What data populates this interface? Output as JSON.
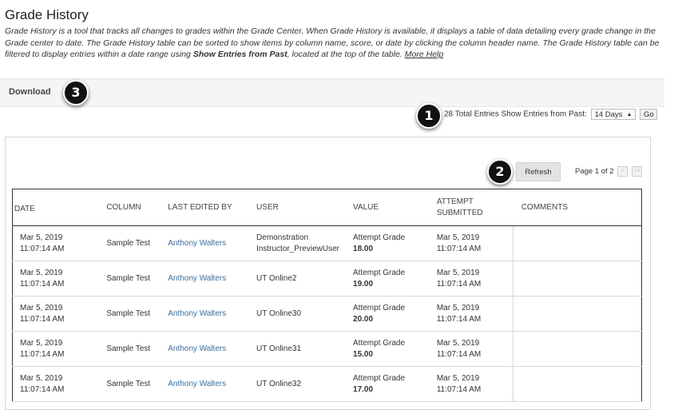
{
  "page": {
    "title": "Grade History",
    "description_part1": "Grade History is a tool that tracks all changes to grades within the Grade Center. When Grade History is available, it displays a table of data detailing every grade change in the Grade center to date. The Grade History table can be sorted to show items by column name, score, or date by clicking the column header name. The Grade History table can be filtered to display entries within a date range using ",
    "description_bold": "Show Entries from Past",
    "description_part2": ", located at the top of the table. ",
    "more_help_link": "More Help"
  },
  "toolbar": {
    "download_label": "Download"
  },
  "callouts": {
    "one": "1",
    "two": "2",
    "three": "3"
  },
  "filter": {
    "total_text": "28 Total Entries",
    "show_label": "Show Entries from Past:",
    "selected": "14 Days",
    "go_label": "Go"
  },
  "pager": {
    "refresh_label": "Refresh",
    "page_text": "Page 1 of 2",
    "next": ">",
    "last": ">>"
  },
  "table": {
    "headers": {
      "date": "DATE",
      "column": "COLUMN",
      "last_edited_by": "LAST EDITED BY",
      "user": "USER",
      "value": "VALUE",
      "attempt_submitted_1": "ATTEMPT",
      "attempt_submitted_2": "SUBMITTED",
      "comments": "COMMENTS"
    },
    "rows": [
      {
        "date": "Mar 5, 2019",
        "time": "11:07:14 AM",
        "column": "Sample Test",
        "editor": "Anthony Walters",
        "user_1": "Demonstration",
        "user_2": "Instructor_PreviewUser",
        "value_label": "Attempt Grade",
        "value": "18.00",
        "att_date": "Mar 5, 2019",
        "att_time": "11:07:14 AM"
      },
      {
        "date": "Mar 5, 2019",
        "time": "11:07:14 AM",
        "column": "Sample Test",
        "editor": "Anthony Walters",
        "user_1": "UT Online2",
        "user_2": "",
        "value_label": "Attempt Grade",
        "value": "19.00",
        "att_date": "Mar 5, 2019",
        "att_time": "11:07:14 AM"
      },
      {
        "date": "Mar 5, 2019",
        "time": "11:07:14 AM",
        "column": "Sample Test",
        "editor": "Anthony Walters",
        "user_1": "UT Online30",
        "user_2": "",
        "value_label": "Attempt Grade",
        "value": "20.00",
        "att_date": "Mar 5, 2019",
        "att_time": "11:07:14 AM"
      },
      {
        "date": "Mar 5, 2019",
        "time": "11:07:14 AM",
        "column": "Sample Test",
        "editor": "Anthony Walters",
        "user_1": "UT Online31",
        "user_2": "",
        "value_label": "Attempt Grade",
        "value": "15.00",
        "att_date": "Mar 5, 2019",
        "att_time": "11:07:14 AM"
      },
      {
        "date": "Mar 5, 2019",
        "time": "11:07:14 AM",
        "column": "Sample Test",
        "editor": "Anthony Walters",
        "user_1": "UT Online32",
        "user_2": "",
        "value_label": "Attempt Grade",
        "value": "17.00",
        "att_date": "Mar 5, 2019",
        "att_time": "11:07:14 AM"
      }
    ]
  }
}
